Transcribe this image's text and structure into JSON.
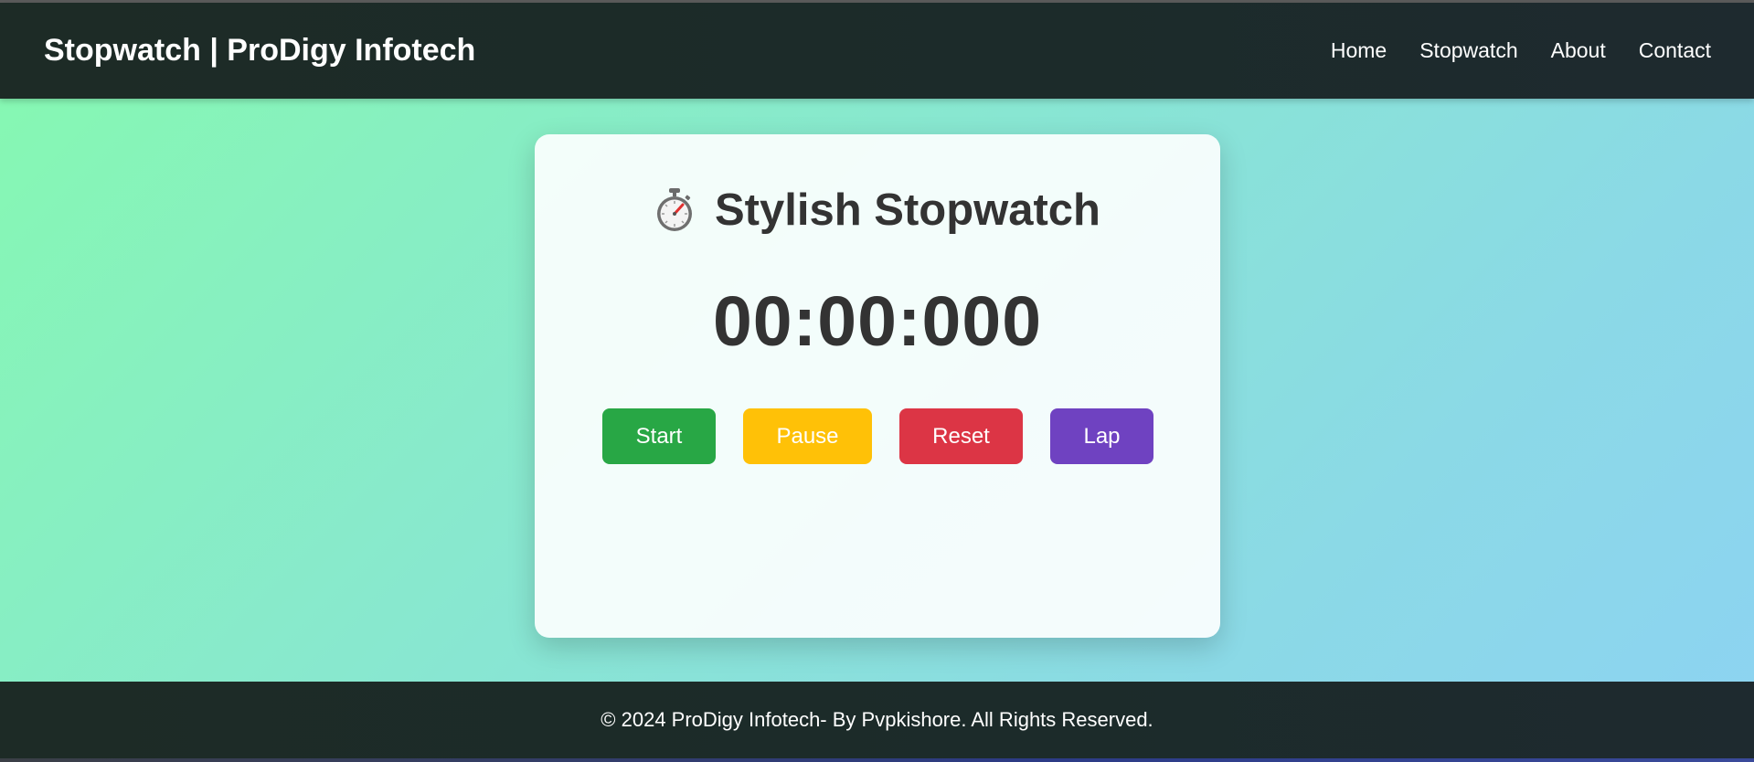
{
  "header": {
    "brand": "Stopwatch | ProDigy Infotech",
    "nav": [
      "Home",
      "Stopwatch",
      "About",
      "Contact"
    ]
  },
  "card": {
    "icon": "stopwatch-icon",
    "title": "Stylish Stopwatch",
    "time": "00:00:000",
    "buttons": {
      "start": "Start",
      "pause": "Pause",
      "reset": "Reset",
      "lap": "Lap"
    }
  },
  "footer": {
    "copyright": "© 2024 ProDigy Infotech- By Pvpkishore. All Rights Reserved."
  },
  "colors": {
    "header_bg": "#1c2b2a",
    "start": "#28a745",
    "pause": "#ffc107",
    "reset": "#dc3545",
    "lap": "#6f42c1",
    "text_dark": "#333333"
  }
}
